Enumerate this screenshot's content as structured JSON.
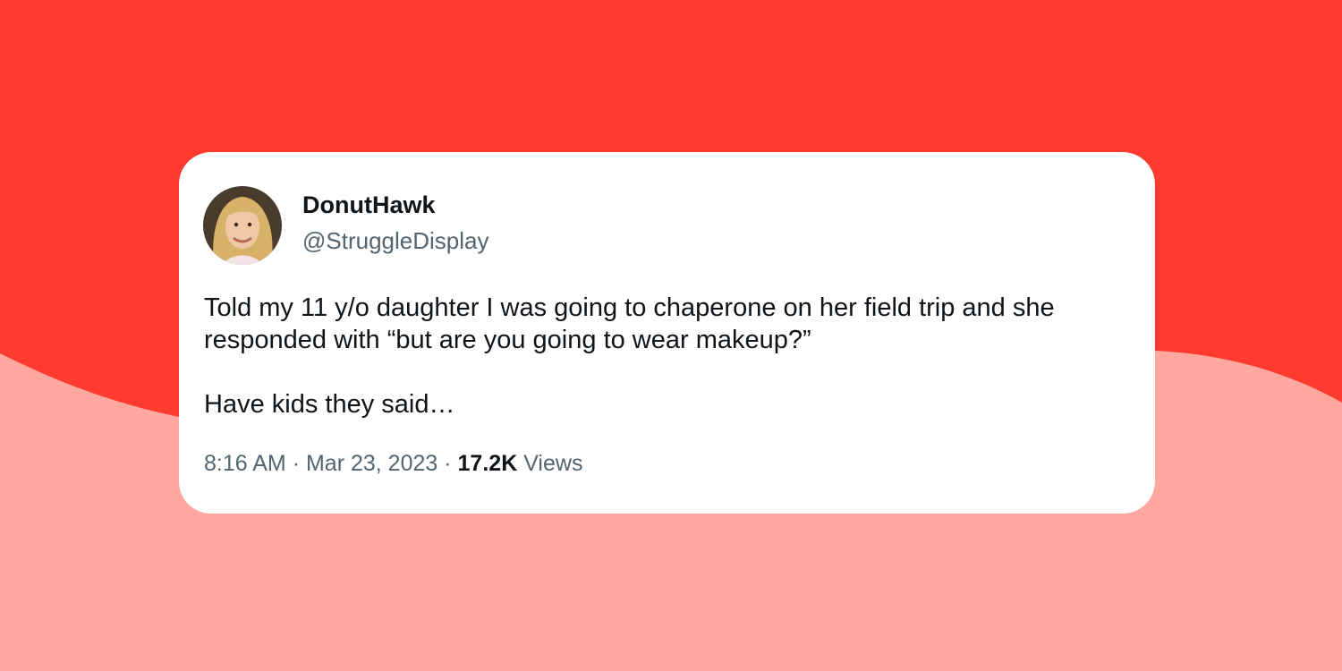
{
  "colors": {
    "background_top": "#ff3b30",
    "background_bottom": "#ffa8a0",
    "card": "#ffffff",
    "text_primary": "#0f1419",
    "text_secondary": "#536471"
  },
  "tweet": {
    "author": {
      "display_name": "DonutHawk",
      "handle": "@StruggleDisplay",
      "avatar_icon": "profile-photo"
    },
    "text_line_1": "Told my 11 y/o daughter I was going to chaperone on her field trip and she responded with “but are you going to wear makeup?”",
    "text_line_2": "Have kids they said…",
    "time": "8:16 AM",
    "separator": "·",
    "date": "Mar 23, 2023",
    "views_count": "17.2K",
    "views_label": "Views"
  }
}
